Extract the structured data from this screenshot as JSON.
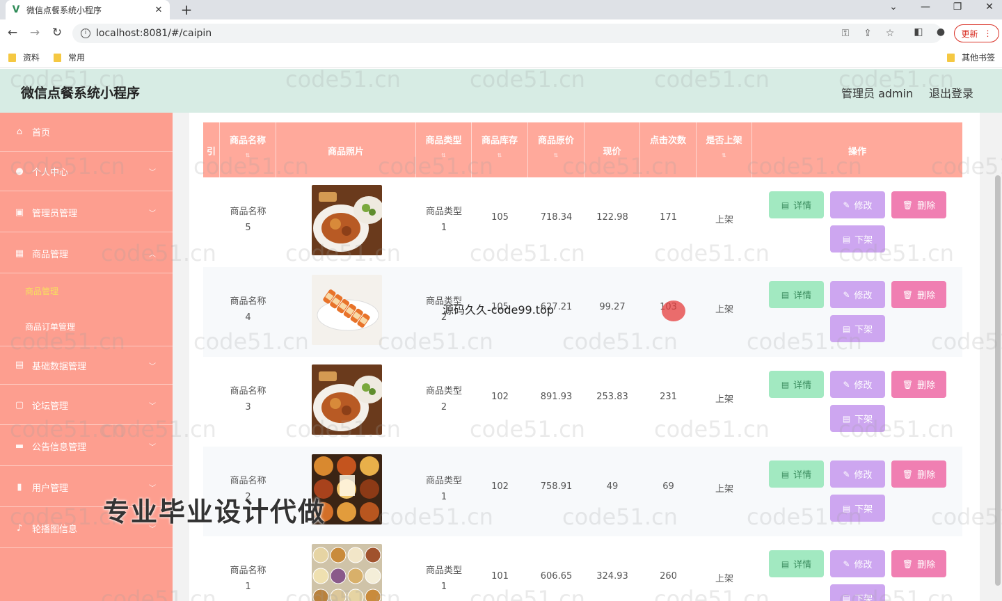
{
  "browser": {
    "tab_title": "微信点餐系统小程序",
    "tab_favicon": "V",
    "close_glyph": "✕",
    "new_tab_glyph": "+",
    "url": "localhost:8081/#/caipin",
    "update_label": "更新",
    "bookmarks": [
      "资料",
      "常用"
    ],
    "other_bookmarks": "其他书签"
  },
  "header": {
    "title": "微信点餐系统小程序",
    "user": "管理员 admin",
    "logout": "退出登录"
  },
  "sidebar": {
    "items": [
      {
        "label": "首页",
        "icon": "home-icon"
      },
      {
        "label": "个人中心",
        "icon": "user-icon"
      },
      {
        "label": "管理员管理",
        "icon": "admin-icon"
      },
      {
        "label": "商品管理",
        "icon": "grid-icon"
      },
      {
        "label": "基础数据管理",
        "icon": "table-icon"
      },
      {
        "label": "论坛管理",
        "icon": "forum-icon"
      },
      {
        "label": "公告信息管理",
        "icon": "message-icon"
      },
      {
        "label": "用户管理",
        "icon": "chart-icon"
      },
      {
        "label": "轮播图信息",
        "icon": "mic-icon"
      }
    ],
    "sub_items": [
      "商品管理",
      "商品订单管理"
    ]
  },
  "table": {
    "headers": [
      "引",
      "商品名称",
      "商品照片",
      "商品类型",
      "商品库存",
      "商品原价",
      "现价",
      "点击次数",
      "是否上架",
      "操作"
    ],
    "actions": {
      "detail": "详情",
      "edit": "修改",
      "delete": "删除",
      "off": "下架"
    },
    "rows": [
      {
        "name_a": "商品名称",
        "name_b": "5",
        "type_a": "商品类型",
        "type_b": "1",
        "stock": "105",
        "orig": "718.34",
        "price": "122.98",
        "clicks": "171",
        "status": "上架",
        "photo": "food-plate"
      },
      {
        "name_a": "商品名称",
        "name_b": "4",
        "type_a": "商品类型",
        "type_b": "2",
        "stock": "105",
        "orig": "627.21",
        "price": "99.27",
        "clicks": "103",
        "status": "上架",
        "photo": "sushi-roll"
      },
      {
        "name_a": "商品名称",
        "name_b": "3",
        "type_a": "商品类型",
        "type_b": "2",
        "stock": "102",
        "orig": "891.93",
        "price": "253.83",
        "clicks": "231",
        "status": "上架",
        "photo": "food-plate"
      },
      {
        "name_a": "商品名称",
        "name_b": "2",
        "type_a": "商品类型",
        "type_b": "1",
        "stock": "102",
        "orig": "758.91",
        "price": "49",
        "clicks": "69",
        "status": "上架",
        "photo": "food-collage"
      },
      {
        "name_a": "商品名称",
        "name_b": "1",
        "type_a": "商品类型",
        "type_b": "1",
        "stock": "101",
        "orig": "606.65",
        "price": "324.93",
        "clicks": "260",
        "status": "上架",
        "photo": "snack-platter"
      }
    ]
  },
  "overlays": {
    "center_text": "源码久久-code99.top",
    "banner": "专业毕业设计代做",
    "watermark": "code51.cn"
  }
}
